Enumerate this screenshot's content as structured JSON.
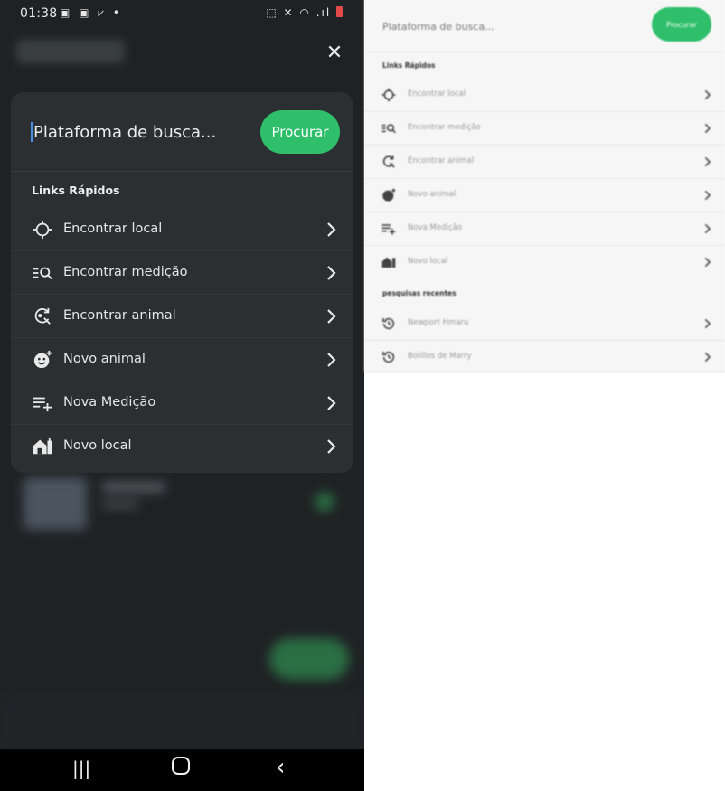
{
  "status_bar": {
    "time": "01:38"
  },
  "search": {
    "placeholder": "Plataforma de busca...",
    "button_label": "Procurar"
  },
  "quick_links": {
    "title": "Links Rápidos",
    "items": [
      {
        "label": "Encontrar local",
        "icon": "crosshair-icon"
      },
      {
        "label": "Encontrar medição",
        "icon": "search-list-icon"
      },
      {
        "label": "Encontrar animal",
        "icon": "find-animal-icon"
      },
      {
        "label": "Novo animal",
        "icon": "add-animal-icon"
      },
      {
        "label": "Nova Medição",
        "icon": "add-measurement-icon"
      },
      {
        "label": "Novo local",
        "icon": "add-location-icon"
      }
    ]
  },
  "light_view": {
    "search_placeholder": "Plataforma de busca...",
    "button_label": "Procurar",
    "quick_links_title": "Links Rápidos",
    "items": [
      {
        "label": "Encontrar local"
      },
      {
        "label": "Encontrar medição"
      },
      {
        "label": "Encontrar animal"
      },
      {
        "label": "Novo animal"
      },
      {
        "label": "Nova Medição"
      },
      {
        "label": "Novo local"
      }
    ],
    "recent_title": "pesquisas recentes",
    "recent": [
      {
        "label": "Newport Hmaru"
      },
      {
        "label": "Bolillos de Marry"
      }
    ]
  },
  "colors": {
    "accent": "#2fbf6b",
    "dark_bg": "#1f2224",
    "card_bg": "#2c2f31"
  }
}
